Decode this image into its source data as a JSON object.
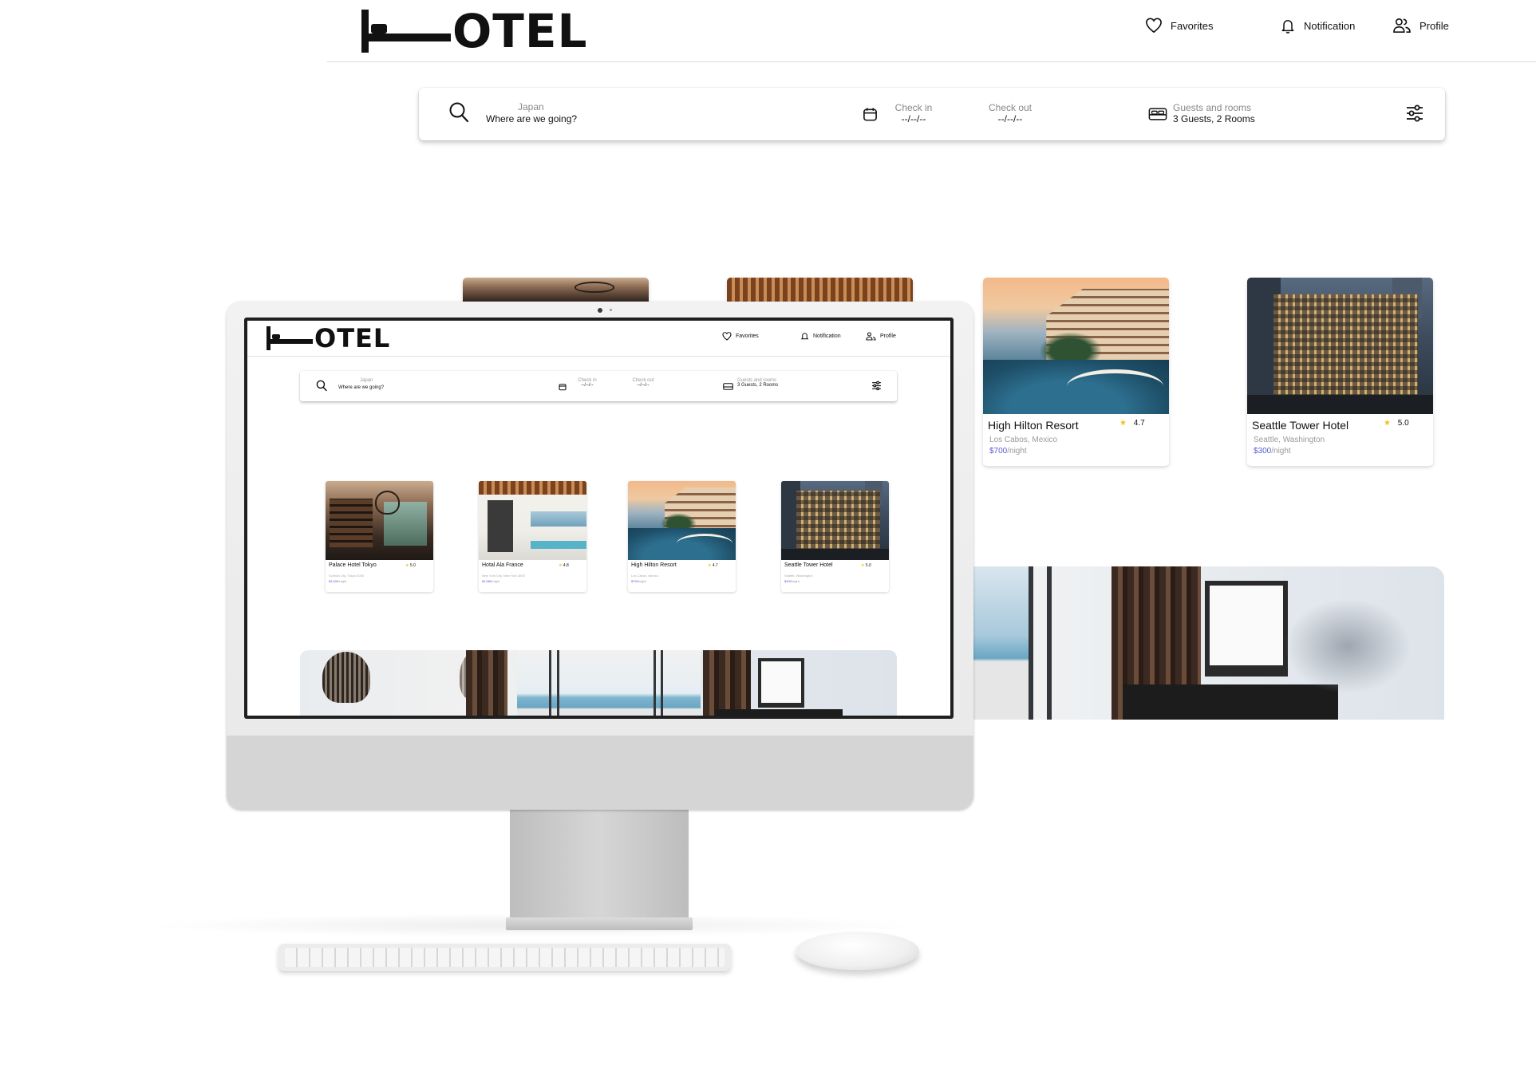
{
  "brand": {
    "logo_text": "OTEL"
  },
  "nav": {
    "favorites": "Favorites",
    "notification": "Notification",
    "profile": "Profile"
  },
  "search": {
    "destination_label": "Japan",
    "destination_placeholder": "Where are we going?",
    "checkin_label": "Check in",
    "checkin_value": "--/--/--",
    "checkout_label": "Check out",
    "checkout_value": "--/--/--",
    "guests_label": "Guests and rooms",
    "guests_value": "3 Guests, 2 Rooms"
  },
  "hotels": [
    {
      "name": "Palace Hotel Tokyo",
      "rating": "5.0",
      "location": "Sumida City, Tokyo 0045",
      "price": "$3,000",
      "per": "/night"
    },
    {
      "name": "Hotal Ala France",
      "rating": "4.8",
      "location": "New York City, New York 3045",
      "price": "$2,580",
      "per": "/night"
    },
    {
      "name": "High Hilton Resort",
      "rating": "4.7",
      "location": "Los Cabos, Mexico",
      "price": "$700",
      "per": "/night"
    },
    {
      "name": "Seattle Tower Hotel",
      "rating": "5.0",
      "location": "Seattle, Washington",
      "price": "$300",
      "per": "/night"
    }
  ],
  "colors": {
    "accent": "#5b5bd6",
    "star": "#f2c11d",
    "text": "#111111"
  },
  "icons": [
    "search-icon",
    "calendar-icon",
    "bed-icon",
    "filter-icon",
    "heart-icon",
    "bell-icon",
    "users-icon",
    "star-icon"
  ]
}
